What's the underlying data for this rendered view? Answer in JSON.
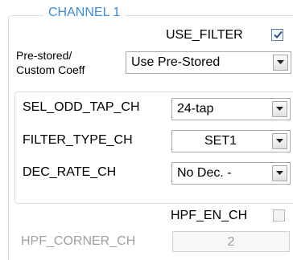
{
  "group": {
    "title": "CHANNEL 1"
  },
  "use_filter": {
    "label": "USE_FILTER",
    "checked": true
  },
  "coeff": {
    "label_line1": "Pre-stored/",
    "label_line2": "Custom Coeff",
    "value": "Use Pre-Stored"
  },
  "sel_odd_tap": {
    "label": "SEL_ODD_TAP_CH",
    "value": "24-tap"
  },
  "filter_type": {
    "label": "FILTER_TYPE_CH",
    "value": "SET1"
  },
  "dec_rate": {
    "label": "DEC_RATE_CH",
    "value": "No Dec. -"
  },
  "hpf_en": {
    "label": "HPF_EN_CH",
    "checked": false
  },
  "hpf_corner": {
    "label": "HPF_CORNER_CH",
    "value": "2"
  },
  "icons": {
    "dropdown": "chevron-down-icon",
    "check": "checkmark-icon"
  },
  "colors": {
    "title": "#3c8fd6",
    "border": "#d5dfe5",
    "disabled_text": "#a0a0a0"
  }
}
